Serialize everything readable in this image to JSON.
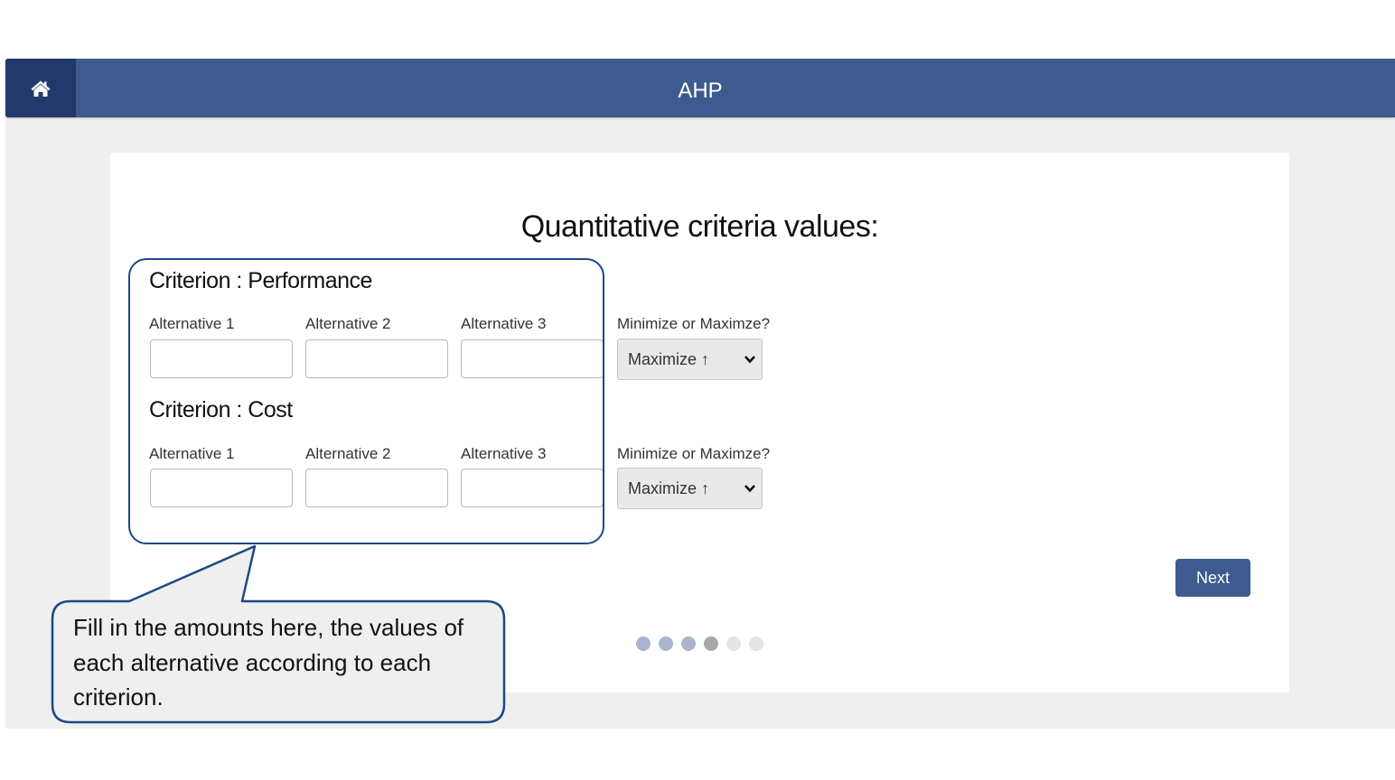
{
  "header": {
    "title": "AHP",
    "home_icon": "home-icon",
    "bar_color": "#3f5a8f",
    "home_color": "#22396e"
  },
  "page": {
    "title": "Quantitative criteria values:"
  },
  "criteria": [
    {
      "title": "Criterion : Performance",
      "alternatives": [
        {
          "label": "Alternative 1",
          "value": ""
        },
        {
          "label": "Alternative 2",
          "value": ""
        },
        {
          "label": "Alternative 3",
          "value": ""
        }
      ],
      "direction_label": "Minimize or Maximze?",
      "direction_value": "Maximize ↑"
    },
    {
      "title": "Criterion : Cost",
      "alternatives": [
        {
          "label": "Alternative 1",
          "value": ""
        },
        {
          "label": "Alternative 2",
          "value": ""
        },
        {
          "label": "Alternative 3",
          "value": ""
        }
      ],
      "direction_label": "Minimize or Maximze?",
      "direction_value": "Maximize ↑"
    }
  ],
  "buttons": {
    "next": "Next"
  },
  "pagination": {
    "total_steps": 6,
    "current_step": 4,
    "done_color": "#aab4cd",
    "current_color": "#a8a8a8",
    "todo_color": "#e4e4e4"
  },
  "callout": {
    "text": "Fill in the amounts here, the values of each alternative according to each criterion.",
    "border_color": "#1c4a84",
    "fill_color": "#efefef"
  }
}
